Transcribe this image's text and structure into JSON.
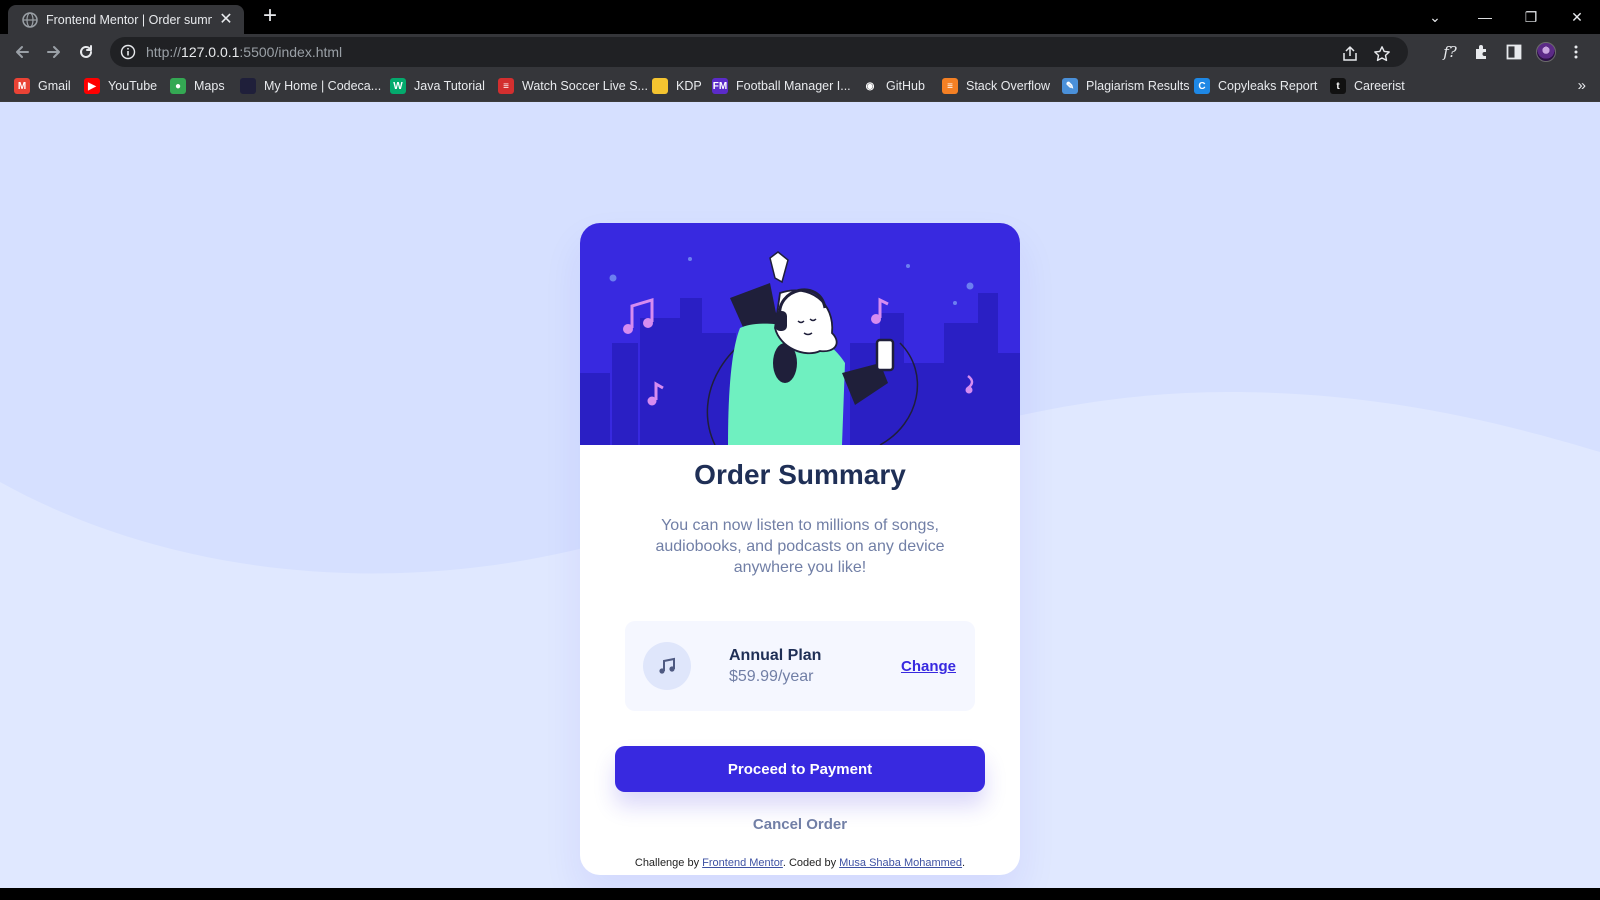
{
  "browser": {
    "tab_title": "Frontend Mentor | Order summary",
    "tab_close": "✕",
    "new_tab": "+",
    "window_controls": {
      "tab_search": "⌄",
      "minimize": "—",
      "restore": "❐",
      "close": "✕"
    },
    "url_scheme": "http://",
    "url_host": "127.0.0.1",
    "url_rest": ":5500/index.html",
    "toolbar_icons": [
      "share-icon",
      "star-icon",
      "f-icon",
      "extensions-icon",
      "sidepanel-icon",
      "profile-avatar",
      "menu-icon"
    ],
    "f_label": "f?",
    "bookmarks": [
      {
        "label": "Gmail",
        "icon": "gmail-icon",
        "color": "#ea4335",
        "glyph": "M"
      },
      {
        "label": "YouTube",
        "icon": "youtube-icon",
        "color": "#ff0000",
        "glyph": "▶"
      },
      {
        "label": "Maps",
        "icon": "maps-icon",
        "color": "#34a853",
        "glyph": "●"
      },
      {
        "label": "My Home | Codeca...",
        "icon": "codecademy-icon",
        "color": "#1f1f3a",
        "glyph": ""
      },
      {
        "label": "Java Tutorial",
        "icon": "w3schools-icon",
        "color": "#04aa6d",
        "glyph": "W"
      },
      {
        "label": "Watch Soccer Live S...",
        "icon": "soccer-icon",
        "color": "#d32f2f",
        "glyph": "≡"
      },
      {
        "label": "KDP",
        "icon": "kdp-icon",
        "color": "#f4c430",
        "glyph": ""
      },
      {
        "label": "Football Manager I...",
        "icon": "fm-icon",
        "color": "#5b2bc9",
        "glyph": "FM"
      },
      {
        "label": "GitHub",
        "icon": "github-icon",
        "color": "#35363a",
        "glyph": "◉"
      },
      {
        "label": "Stack Overflow",
        "icon": "stackoverflow-icon",
        "color": "#f48024",
        "glyph": "≡"
      },
      {
        "label": "Plagiarism Results",
        "icon": "plagiarism-icon",
        "color": "#4a90d9",
        "glyph": "✎"
      },
      {
        "label": "Copyleaks Report",
        "icon": "copyleaks-icon",
        "color": "#1e88e5",
        "glyph": "C"
      },
      {
        "label": "Careerist",
        "icon": "careerist-icon",
        "color": "#111111",
        "glyph": "t"
      }
    ],
    "bookmarks_more": "»"
  },
  "card": {
    "title": "Order Summary",
    "description": "You can now listen to millions of songs, audiobooks, and podcasts on any device anywhere you like!",
    "plan_name": "Annual Plan",
    "plan_price": "$59.99/year",
    "change_label": "Change",
    "pay_label": "Proceed to Payment",
    "cancel_label": "Cancel Order"
  },
  "attribution": {
    "prefix": "Challenge by ",
    "fm_link": "Frontend Mentor",
    "middle": ". Coded by ",
    "author_link": "Musa Shaba Mohammed",
    "suffix": "."
  },
  "colors": {
    "page_bg": "#e0e8ff",
    "wave": "#d6e0ff",
    "hero_bg": "#3829e0",
    "primary": "#3829e0",
    "title": "#1f2f56",
    "muted": "#717fa6",
    "plan_bg": "#f5f7ff"
  }
}
